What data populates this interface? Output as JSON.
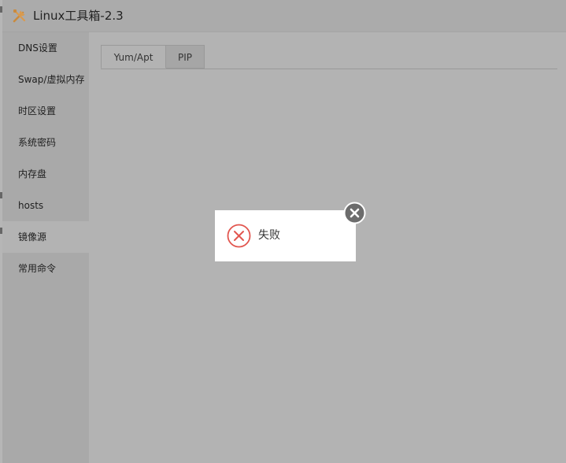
{
  "window": {
    "title": "Linux工具箱-2.3"
  },
  "sidebar": {
    "items": [
      {
        "label": "DNS设置"
      },
      {
        "label": "Swap/虚拟内存"
      },
      {
        "label": "时区设置"
      },
      {
        "label": "系统密码"
      },
      {
        "label": "内存盘"
      },
      {
        "label": "hosts"
      },
      {
        "label": "镜像源",
        "active": true
      },
      {
        "label": "常用命令"
      }
    ]
  },
  "tabs": [
    {
      "label": "Yum/Apt",
      "active": true
    },
    {
      "label": "PIP",
      "active": false
    }
  ],
  "dialog": {
    "message": "失败",
    "icon": "fail-x-circle-icon",
    "close_icon": "close-icon"
  },
  "colors": {
    "error_red": "#e2564f",
    "close_gray": "#6c6c6c",
    "app_icon_orange": "#d99a4e"
  }
}
